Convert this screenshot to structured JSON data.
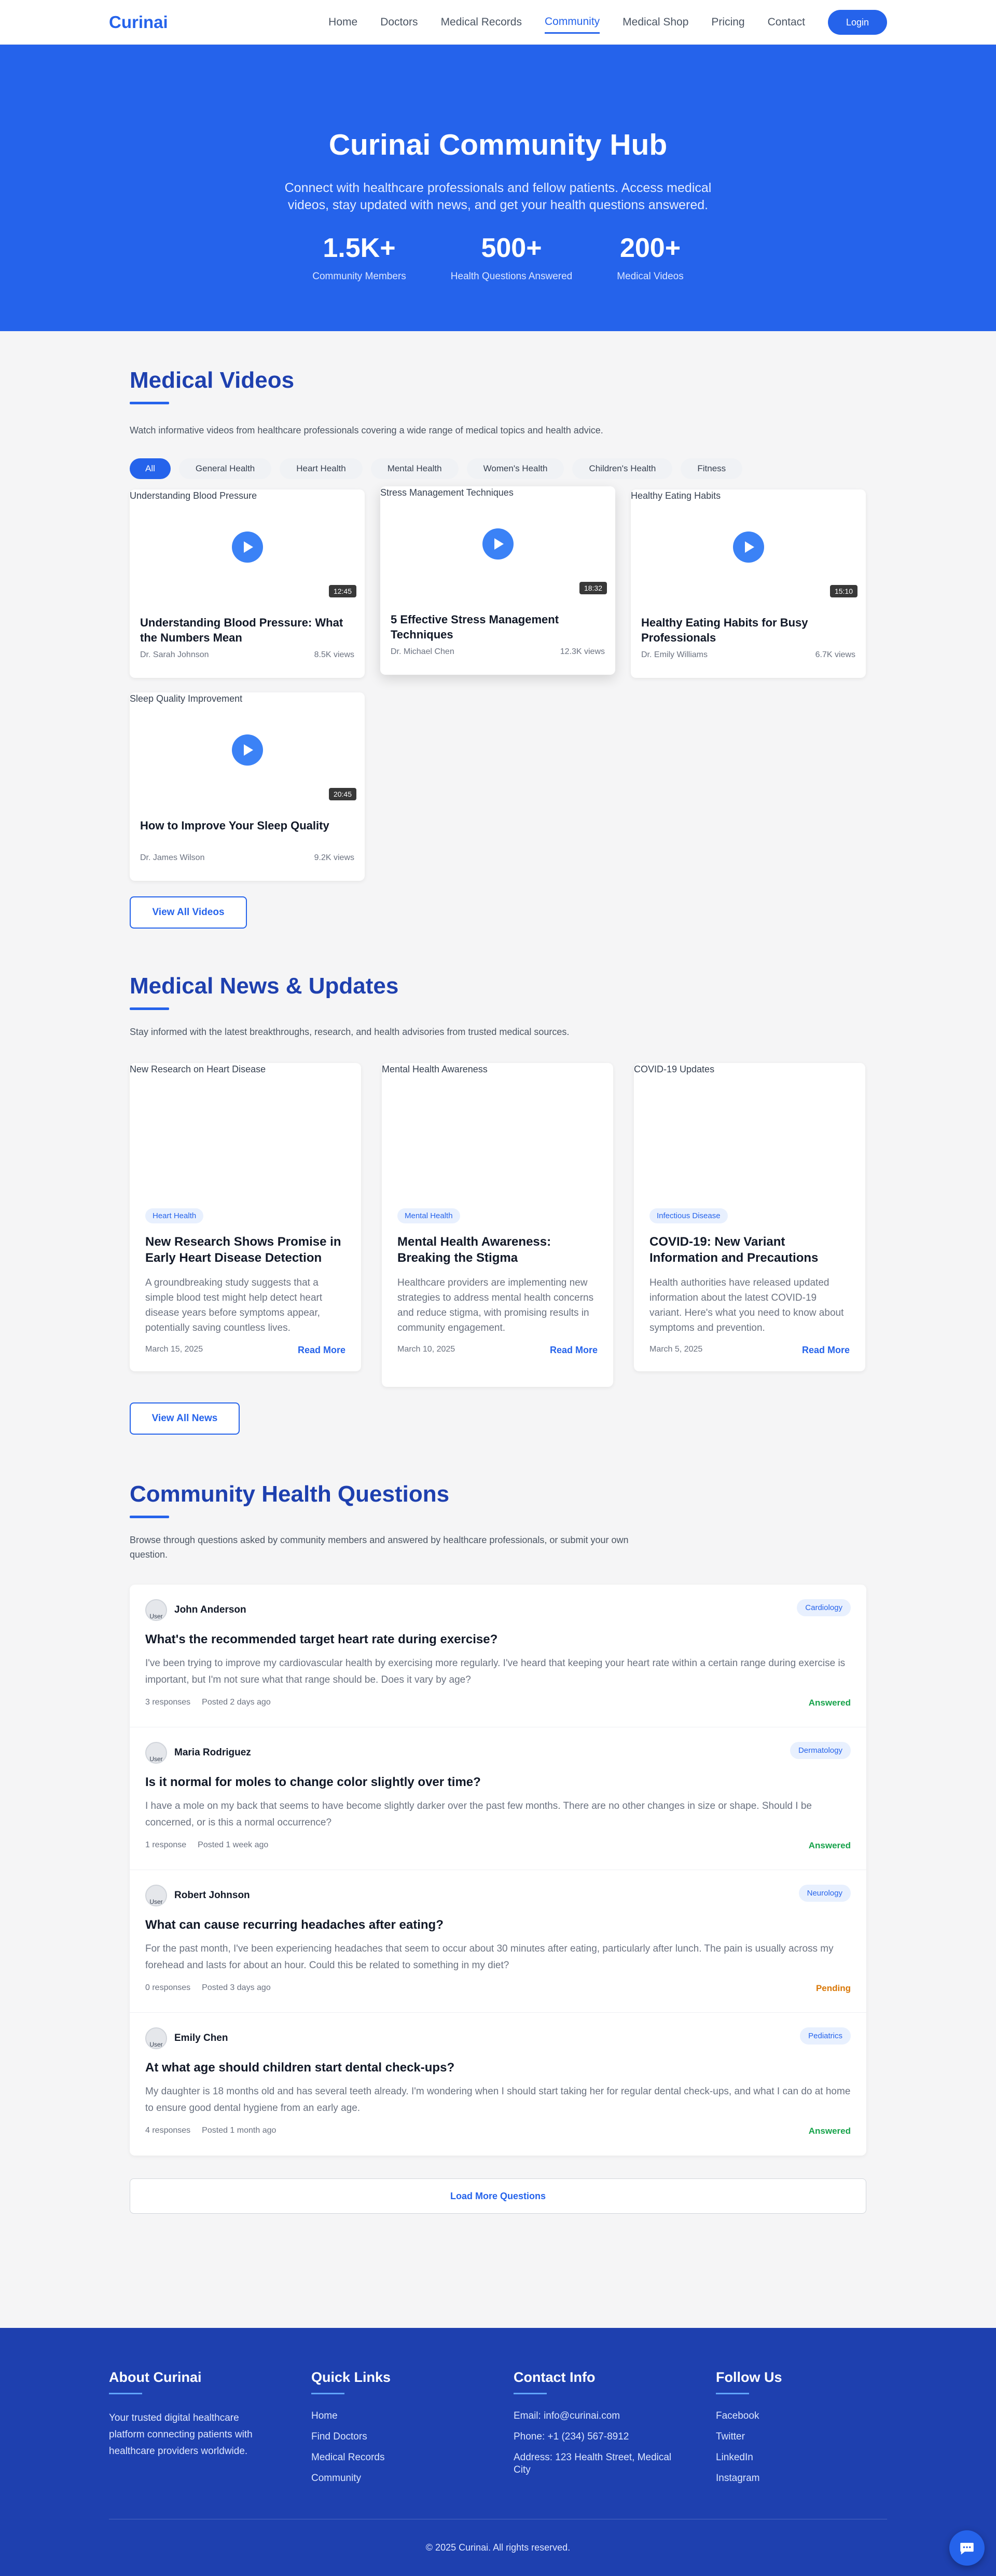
{
  "nav": {
    "logo": "Curinai",
    "links": [
      "Home",
      "Doctors",
      "Medical Records",
      "Community",
      "Medical Shop",
      "Pricing",
      "Contact"
    ],
    "active": "Community",
    "login_label": "Login"
  },
  "hero": {
    "title": "Curinai Community Hub",
    "subtitle": "Connect with healthcare professionals and fellow patients. Access medical videos, stay updated with news, and get your health questions answered.",
    "stats": [
      {
        "value": "1.5K+",
        "label": "Community Members"
      },
      {
        "value": "500+",
        "label": "Health Questions Answered"
      },
      {
        "value": "200+",
        "label": "Medical Videos"
      }
    ]
  },
  "videos": {
    "title": "Medical Videos",
    "description": "Watch informative videos from healthcare professionals covering a wide range of medical topics and health advice.",
    "filters": [
      "All",
      "General Health",
      "Heart Health",
      "Mental Health",
      "Women's Health",
      "Children's Health",
      "Fitness"
    ],
    "items": [
      {
        "alt": "Understanding Blood Pressure",
        "duration": "12:45",
        "title": "Understanding Blood Pressure: What the Numbers Mean",
        "author": "Dr. Sarah Johnson",
        "views": "8.5K views"
      },
      {
        "alt": "Stress Management Techniques",
        "duration": "18:32",
        "title": "5 Effective Stress Management Techniques",
        "author": "Dr. Michael Chen",
        "views": "12.3K views"
      },
      {
        "alt": "Healthy Eating Habits",
        "duration": "15:10",
        "title": "Healthy Eating Habits for Busy Professionals",
        "author": "Dr. Emily Williams",
        "views": "6.7K views"
      },
      {
        "alt": "Sleep Quality Improvement",
        "duration": "20:45",
        "title": "How to Improve Your Sleep Quality",
        "author": "Dr. James Wilson",
        "views": "9.2K views"
      }
    ],
    "view_all": "View All Videos"
  },
  "news": {
    "title": "Medical News & Updates",
    "description": "Stay informed with the latest breakthroughs, research, and health advisories from trusted medical sources.",
    "items": [
      {
        "alt": "New Research on Heart Disease",
        "tag": "Heart Health",
        "title": "New Research Shows Promise in Early Heart Disease Detection",
        "excerpt": "A groundbreaking study suggests that a simple blood test might help detect heart disease years before symptoms appear, potentially saving countless lives.",
        "date": "March 15, 2025",
        "read_more": "Read More"
      },
      {
        "alt": "Mental Health Awareness",
        "tag": "Mental Health",
        "title": "Mental Health Awareness: Breaking the Stigma",
        "excerpt": "Healthcare providers are implementing new strategies to address mental health concerns and reduce stigma, with promising results in community engagement.",
        "date": "March 10, 2025",
        "read_more": "Read More"
      },
      {
        "alt": "COVID-19 Updates",
        "tag": "Infectious Disease",
        "title": "COVID-19: New Variant Information and Precautions",
        "excerpt": "Health authorities have released updated information about the latest COVID-19 variant. Here's what you need to know about symptoms and prevention.",
        "date": "March 5, 2025",
        "read_more": "Read More"
      }
    ],
    "view_all": "View All News"
  },
  "questions": {
    "title": "Community Health Questions",
    "description": "Browse through questions asked by community members and answered by healthcare professionals, or submit your own question.",
    "avatar_alt": "User",
    "items": [
      {
        "user": "John Anderson",
        "category": "Cardiology",
        "title": "What's the recommended target heart rate during exercise?",
        "body": "I've been trying to improve my cardiovascular health by exercising more regularly. I've heard that keeping your heart rate within a certain range during exercise is important, but I'm not sure what that range should be. Does it vary by age?",
        "responses": "3 responses",
        "posted": "Posted 2 days ago",
        "status": "Answered"
      },
      {
        "user": "Maria Rodriguez",
        "category": "Dermatology",
        "title": "Is it normal for moles to change color slightly over time?",
        "body": "I have a mole on my back that seems to have become slightly darker over the past few months. There are no other changes in size or shape. Should I be concerned, or is this a normal occurrence?",
        "responses": "1 response",
        "posted": "Posted 1 week ago",
        "status": "Answered"
      },
      {
        "user": "Robert Johnson",
        "category": "Neurology",
        "title": "What can cause recurring headaches after eating?",
        "body": "For the past month, I've been experiencing headaches that seem to occur about 30 minutes after eating, particularly after lunch. The pain is usually across my forehead and lasts for about an hour. Could this be related to something in my diet?",
        "responses": "0 responses",
        "posted": "Posted 3 days ago",
        "status": "Pending"
      },
      {
        "user": "Emily Chen",
        "category": "Pediatrics",
        "title": "At what age should children start dental check-ups?",
        "body": "My daughter is 18 months old and has several teeth already. I'm wondering when I should start taking her for regular dental check-ups, and what I can do at home to ensure good dental hygiene from an early age.",
        "responses": "4 responses",
        "posted": "Posted 1 month ago",
        "status": "Answered"
      }
    ],
    "load_more": "Load More Questions"
  },
  "footer": {
    "about_title": "About Curinai",
    "about_text": "Your trusted digital healthcare platform connecting patients with healthcare providers worldwide.",
    "links_title": "Quick Links",
    "links": [
      "Home",
      "Find Doctors",
      "Medical Records",
      "Community"
    ],
    "contact_title": "Contact Info",
    "contact": [
      "Email: info@curinai.com",
      "Phone: +1 (234) 567-8912",
      "Address: 123 Health Street, Medical City"
    ],
    "follow_title": "Follow Us",
    "social": [
      "Facebook",
      "Twitter",
      "LinkedIn",
      "Instagram"
    ],
    "copyright": "© 2025 Curinai. All rights reserved."
  },
  "colors": {
    "primary": "#2563eb",
    "primary_dark": "#1e40af",
    "answered": "#16a34a",
    "pending": "#d97706"
  }
}
